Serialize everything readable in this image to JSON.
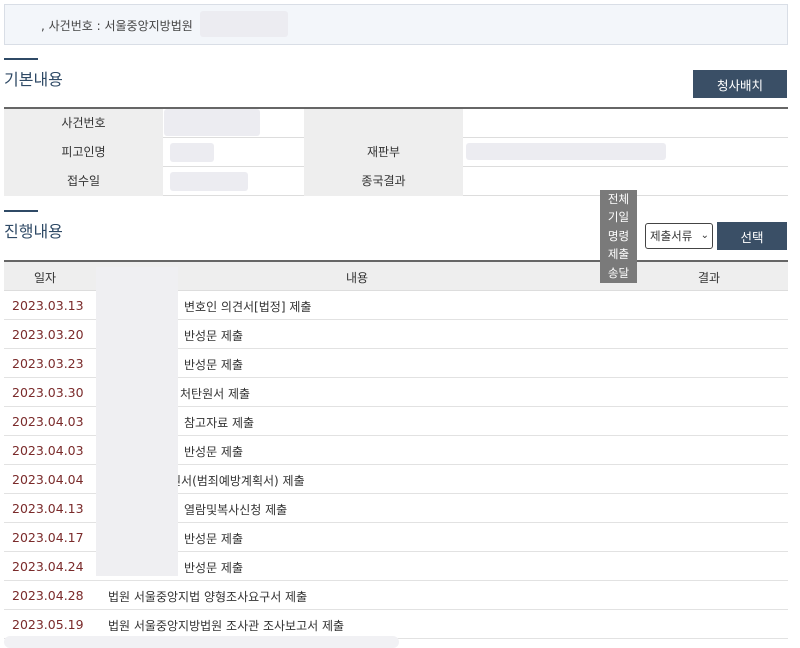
{
  "case_bar": {
    "text": ", 사건번호 : 서울중앙지방법원"
  },
  "basic": {
    "title": "기본내용",
    "button": "청사배치",
    "rows": [
      {
        "label1": "사건번호",
        "label2": ""
      },
      {
        "label1": "피고인명",
        "label2": "재판부"
      },
      {
        "label1": "접수일",
        "label2": "종국결과"
      }
    ]
  },
  "progress": {
    "title": "진행내용",
    "select_value": "제출서류",
    "select_button": "선택",
    "float_menu": [
      "전체",
      "기일",
      "명령",
      "제출",
      "송달"
    ],
    "headers": {
      "date": "일자",
      "content": "내용",
      "result": "결과"
    },
    "rows": [
      {
        "date": "2023.03.13",
        "content": "변호인 의견서[법정] 제출"
      },
      {
        "date": "2023.03.20",
        "content": "반성문 제출"
      },
      {
        "date": "2023.03.23",
        "content": "반성문 제출"
      },
      {
        "date": "2023.03.30",
        "content": "처탄원서 제출"
      },
      {
        "date": "2023.04.03",
        "content": "참고자료 제출"
      },
      {
        "date": "2023.04.03",
        "content": "반성문 제출"
      },
      {
        "date": "2023.04.04",
        "content": "원서(범죄예방계획서) 제출"
      },
      {
        "date": "2023.04.13",
        "content": "열람및복사신청 제출"
      },
      {
        "date": "2023.04.17",
        "content": "반성문 제출"
      },
      {
        "date": "2023.04.24",
        "content": "반성문 제출"
      },
      {
        "date": "2023.04.28",
        "content": "법원 서울중앙지법 양형조사요구서 제출"
      },
      {
        "date": "2023.05.19",
        "content": "법원 서울중앙지방법원 조사관 조사보고서 제출"
      }
    ]
  }
}
